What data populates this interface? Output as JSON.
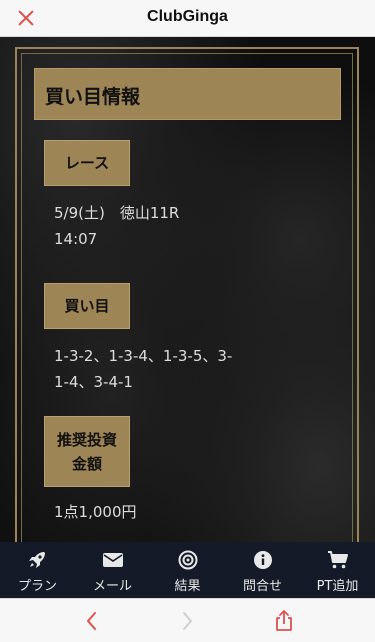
{
  "app": {
    "title": "ClubGinga"
  },
  "section": {
    "title": "買い目情報"
  },
  "race": {
    "label": "レース",
    "date": "5/9(土)　徳山11R",
    "time": "14:07"
  },
  "bets": {
    "label": "買い目",
    "line1": "1-3-2、1-3-4、1-3-5、3-",
    "line2": "1-4、3-4-1"
  },
  "investment": {
    "label_line1": "推奨投資",
    "label_line2": "金額",
    "value": "1点1,000円"
  },
  "nav": {
    "items": [
      {
        "label": "プラン",
        "icon": "rocket-icon"
      },
      {
        "label": "メール",
        "icon": "envelope-icon"
      },
      {
        "label": "結果",
        "icon": "target-icon"
      },
      {
        "label": "問合せ",
        "icon": "info-icon"
      },
      {
        "label": "PT追加",
        "icon": "cart-icon"
      }
    ]
  },
  "colors": {
    "gold": "#9e8556",
    "close_red": "#d9534f",
    "nav_bg": "#141a27"
  }
}
